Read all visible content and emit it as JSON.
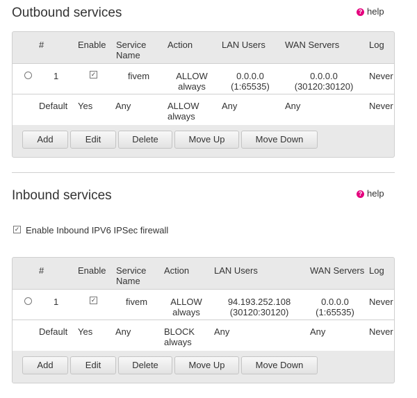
{
  "outbound": {
    "title": "Outbound services",
    "help": "help",
    "headers": {
      "num": "#",
      "enable": "Enable",
      "service1": "Service",
      "service2": "Name",
      "action": "Action",
      "lan": "LAN Users",
      "wan": "WAN Servers",
      "log": "Log"
    },
    "row1": {
      "num": "1",
      "enable_checked": true,
      "service": "fivem",
      "action1": "ALLOW",
      "action2": "always",
      "lan1": "0.0.0.0",
      "lan2": "(1:65535)",
      "wan1": "0.0.0.0",
      "wan2": "(30120:30120)",
      "log": "Never"
    },
    "default": {
      "num": "Default",
      "enable": "Yes",
      "service": "Any",
      "action1": "ALLOW",
      "action2": "always",
      "lan": "Any",
      "wan": "Any",
      "log": "Never"
    },
    "buttons": {
      "add": "Add",
      "edit": "Edit",
      "delete": "Delete",
      "up": "Move Up",
      "down": "Move Down"
    }
  },
  "inbound": {
    "title": "Inbound services",
    "help": "help",
    "ipsec_label": "Enable Inbound IPV6 IPSec firewall",
    "ipsec_checked": true,
    "headers": {
      "num": "#",
      "enable": "Enable",
      "service1": "Service",
      "service2": "Name",
      "action": "Action",
      "lan": "LAN Users",
      "wan": "WAN Servers",
      "log": "Log"
    },
    "row1": {
      "num": "1",
      "enable_checked": true,
      "service": "fivem",
      "action1": "ALLOW",
      "action2": "always",
      "lan1": "94.193.252.108",
      "lan2": "(30120:30120)",
      "wan1": "0.0.0.0",
      "wan2": "(1:65535)",
      "log": "Never"
    },
    "default": {
      "num": "Default",
      "enable": "Yes",
      "service": "Any",
      "action1": "BLOCK",
      "action2": "always",
      "lan": "Any",
      "wan": "Any",
      "log": "Never"
    },
    "buttons": {
      "add": "Add",
      "edit": "Edit",
      "delete": "Delete",
      "up": "Move Up",
      "down": "Move Down"
    }
  },
  "icons": {
    "help": "help-icon",
    "checkbox": "checkbox-icon",
    "radio": "radio-icon"
  },
  "colors": {
    "help_accent": "#e4007d",
    "panel": "#e9e9e9",
    "row": "#ffffff"
  }
}
